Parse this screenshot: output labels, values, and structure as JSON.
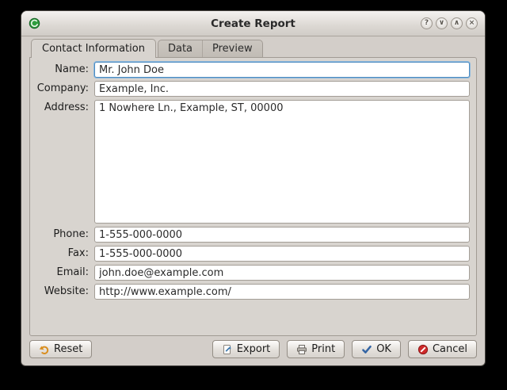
{
  "window": {
    "title": "Create Report",
    "controls": [
      {
        "name": "help",
        "glyph": "?"
      },
      {
        "name": "shade",
        "glyph": "∨"
      },
      {
        "name": "unshade",
        "glyph": "∧"
      },
      {
        "name": "close",
        "glyph": "×"
      }
    ]
  },
  "tabs": [
    {
      "label": "Contact Information",
      "active": true
    },
    {
      "label": "Data",
      "active": false
    },
    {
      "label": "Preview",
      "active": false
    }
  ],
  "form": {
    "name": {
      "label": "Name:",
      "value": "Mr. John Doe"
    },
    "company": {
      "label": "Company:",
      "value": "Example, Inc."
    },
    "address": {
      "label": "Address:",
      "value": "1 Nowhere Ln., Example, ST, 00000"
    },
    "phone": {
      "label": "Phone:",
      "value": "1-555-000-0000"
    },
    "fax": {
      "label": "Fax:",
      "value": "1-555-000-0000"
    },
    "email": {
      "label": "Email:",
      "value": "john.doe@example.com"
    },
    "website": {
      "label": "Website:",
      "value": "http://www.example.com/"
    }
  },
  "buttons": {
    "reset": "Reset",
    "export": "Export",
    "print": "Print",
    "ok": "OK",
    "cancel": "Cancel"
  },
  "colors": {
    "focus_border": "#4d8bbf",
    "ok_check": "#3465a4",
    "cancel_red": "#cf2a2a",
    "reset_arrow": "#d98e1f",
    "app_icon_green": "#2e9e3e"
  }
}
